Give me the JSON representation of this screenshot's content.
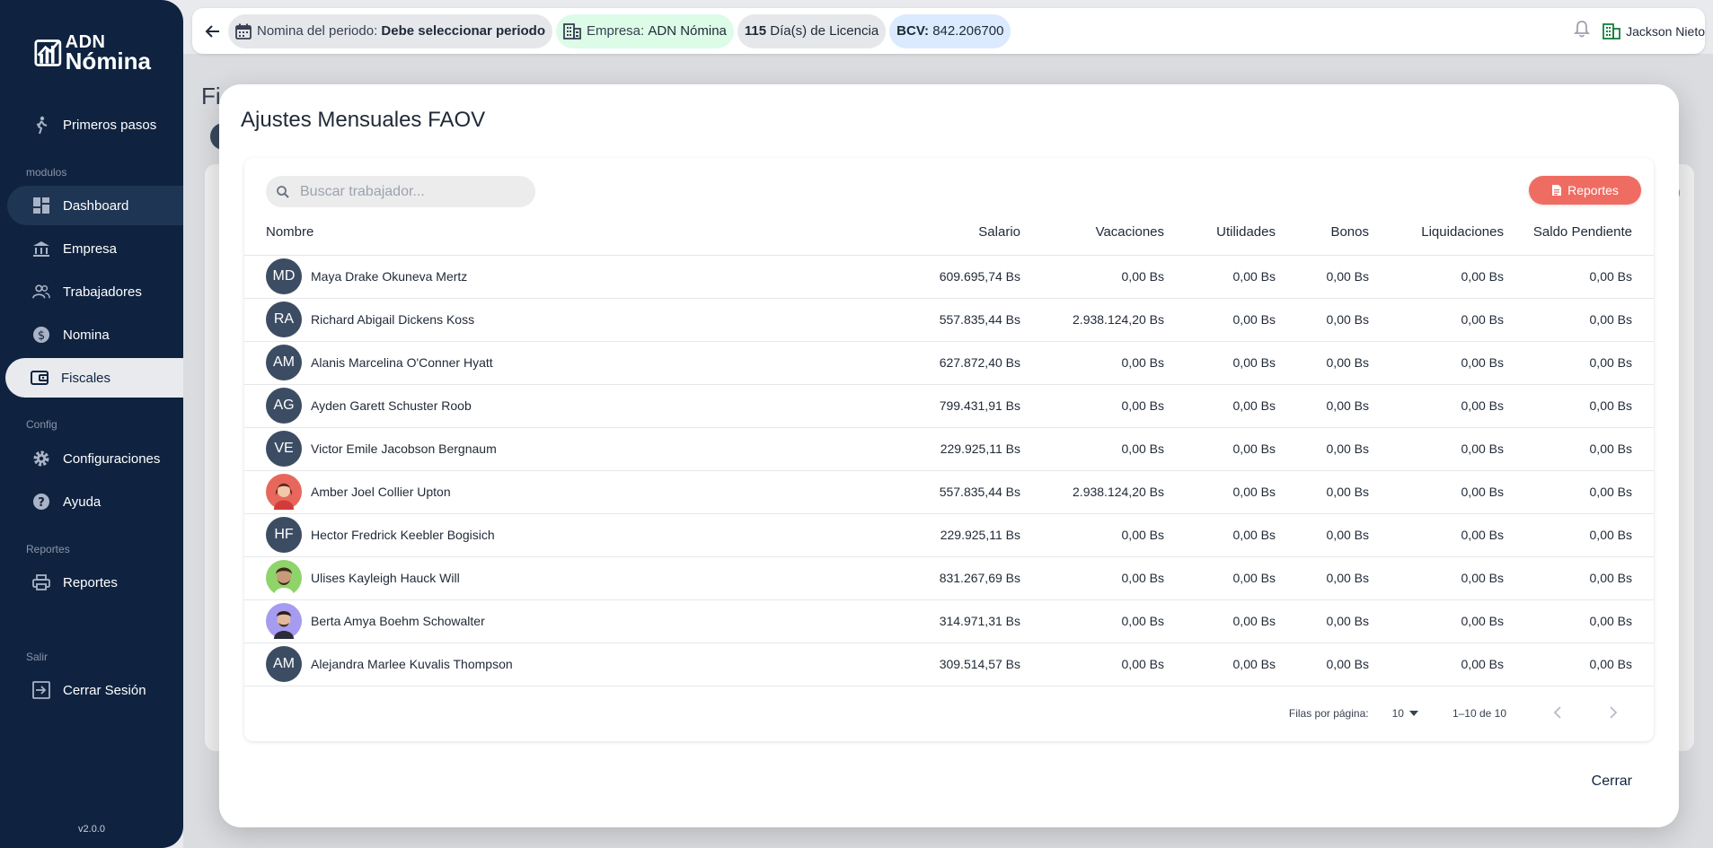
{
  "sidebar": {
    "logo": {
      "line1": "ADN",
      "line2": "Nómina"
    },
    "items": [
      {
        "label": "Primeros pasos",
        "icon": "walk-icon"
      },
      {
        "label": "Dashboard",
        "icon": "dashboard-icon"
      },
      {
        "label": "Empresa",
        "icon": "bank-icon"
      },
      {
        "label": "Trabajadores",
        "icon": "people-icon"
      },
      {
        "label": "Nomina",
        "icon": "dollar-icon"
      },
      {
        "label": "Fiscales",
        "icon": "wallet-icon"
      },
      {
        "label": "Configuraciones",
        "icon": "gear-icon"
      },
      {
        "label": "Ayuda",
        "icon": "help-icon"
      },
      {
        "label": "Reportes",
        "icon": "printer-icon"
      },
      {
        "label": "Cerrar Sesión",
        "icon": "logout-icon"
      }
    ],
    "sections": {
      "modulos": "modulos",
      "config": "Config",
      "reportes": "Reportes",
      "salir": "Salir"
    },
    "version": "v2.0.0"
  },
  "topbar": {
    "period_key": "Nomina del periodo:",
    "period_value": "Debe seleccionar periodo",
    "company_key": "Empresa:",
    "company_value": "ADN Nómina",
    "license_count": "115",
    "license_text": "Día(s) de Licencia",
    "bcv_key": "BCV:",
    "bcv_value": "842.206700",
    "user_name": "Jackson Nieto"
  },
  "background": {
    "title": "Fi"
  },
  "modal": {
    "title": "Ajustes Mensuales FAOV",
    "search_placeholder": "Buscar trabajador...",
    "reports_label": "Reportes",
    "columns": [
      "Nombre",
      "Salario",
      "Vacaciones",
      "Utilidades",
      "Bonos",
      "Liquidaciones",
      "Saldo Pendiente"
    ],
    "rows": [
      {
        "initials": "MD",
        "name": "Maya Drake Okuneva Mertz",
        "salario": "609.695,74 Bs",
        "vacaciones": "0,00 Bs",
        "utilidades": "0,00 Bs",
        "bonos": "0,00 Bs",
        "liquidaciones": "0,00 Bs",
        "saldo": "0,00 Bs",
        "photo": ""
      },
      {
        "initials": "RA",
        "name": "Richard Abigail Dickens Koss",
        "salario": "557.835,44 Bs",
        "vacaciones": "2.938.124,20 Bs",
        "utilidades": "0,00 Bs",
        "bonos": "0,00 Bs",
        "liquidaciones": "0,00 Bs",
        "saldo": "0,00 Bs",
        "photo": ""
      },
      {
        "initials": "AM",
        "name": "Alanis Marcelina O'Conner Hyatt",
        "salario": "627.872,40 Bs",
        "vacaciones": "0,00 Bs",
        "utilidades": "0,00 Bs",
        "bonos": "0,00 Bs",
        "liquidaciones": "0,00 Bs",
        "saldo": "0,00 Bs",
        "photo": ""
      },
      {
        "initials": "AG",
        "name": "Ayden Garett Schuster Roob",
        "salario": "799.431,91 Bs",
        "vacaciones": "0,00 Bs",
        "utilidades": "0,00 Bs",
        "bonos": "0,00 Bs",
        "liquidaciones": "0,00 Bs",
        "saldo": "0,00 Bs",
        "photo": ""
      },
      {
        "initials": "VE",
        "name": "Victor Emile Jacobson Bergnaum",
        "salario": "229.925,11 Bs",
        "vacaciones": "0,00 Bs",
        "utilidades": "0,00 Bs",
        "bonos": "0,00 Bs",
        "liquidaciones": "0,00 Bs",
        "saldo": "0,00 Bs",
        "photo": ""
      },
      {
        "initials": "",
        "name": "Amber Joel Collier Upton",
        "salario": "557.835,44 Bs",
        "vacaciones": "2.938.124,20 Bs",
        "utilidades": "0,00 Bs",
        "bonos": "0,00 Bs",
        "liquidaciones": "0,00 Bs",
        "saldo": "0,00 Bs",
        "photo": "woman-red"
      },
      {
        "initials": "HF",
        "name": "Hector Fredrick Keebler Bogisich",
        "salario": "229.925,11 Bs",
        "vacaciones": "0,00 Bs",
        "utilidades": "0,00 Bs",
        "bonos": "0,00 Bs",
        "liquidaciones": "0,00 Bs",
        "saldo": "0,00 Bs",
        "photo": ""
      },
      {
        "initials": "",
        "name": "Ulises Kayleigh Hauck Will",
        "salario": "831.267,69 Bs",
        "vacaciones": "0,00 Bs",
        "utilidades": "0,00 Bs",
        "bonos": "0,00 Bs",
        "liquidaciones": "0,00 Bs",
        "saldo": "0,00 Bs",
        "photo": "man-green"
      },
      {
        "initials": "",
        "name": "Berta Amya Boehm Schowalter",
        "salario": "314.971,31 Bs",
        "vacaciones": "0,00 Bs",
        "utilidades": "0,00 Bs",
        "bonos": "0,00 Bs",
        "liquidaciones": "0,00 Bs",
        "saldo": "0,00 Bs",
        "photo": "man-purple"
      },
      {
        "initials": "AM",
        "name": "Alejandra Marlee Kuvalis Thompson",
        "salario": "309.514,57 Bs",
        "vacaciones": "0,00 Bs",
        "utilidades": "0,00 Bs",
        "bonos": "0,00 Bs",
        "liquidaciones": "0,00 Bs",
        "saldo": "0,00 Bs",
        "photo": ""
      }
    ],
    "pagination": {
      "rows_label": "Filas por página:",
      "rows_value": "10",
      "range": "1–10 de 10"
    },
    "close_label": "Cerrar"
  },
  "colors": {
    "sidebar": "#0f2340",
    "accent_red": "#ef6c62",
    "avatar": "#3c4d63",
    "chip_green": "#dcfce7",
    "chip_blue": "#dbeafe"
  }
}
